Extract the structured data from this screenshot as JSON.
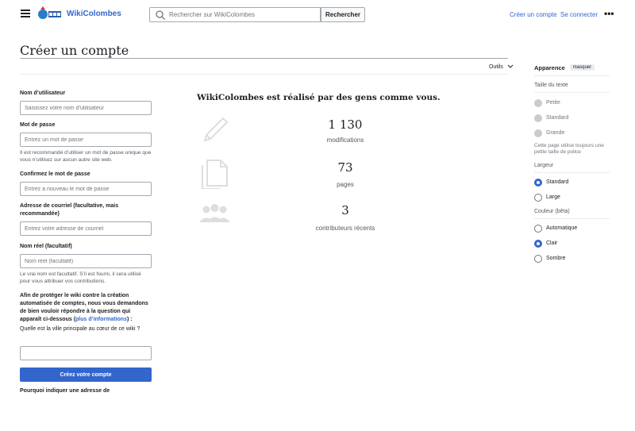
{
  "header": {
    "site_name": "WikiColombes",
    "search_placeholder": "Rechercher sur WikiColombes",
    "search_button": "Rechercher",
    "create_account": "Créer un compte",
    "login": "Se connecter",
    "more": "•••"
  },
  "page": {
    "title": "Créer un compte",
    "tools": "Outils"
  },
  "form": {
    "username_label": "Nom d’utilisateur",
    "username_placeholder": "Saisissez votre nom d’utilisateur",
    "password_label": "Mot de passe",
    "password_placeholder": "Entrez un mot de passe",
    "password_help": "Il est recommandé d’utiliser un mot de passe unique que vous n’utilisez sur aucun autre site web.",
    "confirm_label": "Confirmez le mot de passe",
    "confirm_placeholder": "Entrez à nouveau le mot de passe",
    "email_label": "Adresse de courriel (facultative, mais recommandée)",
    "email_placeholder": "Entrez votre adresse de courriel",
    "realname_label": "Nom réel (facultatif)",
    "realname_placeholder": "Nom réel (facultatif)",
    "realname_help": "Le vrai nom est facultatif. S’il est fourni, il sera utilisé pour vous attribuer vos contributions.",
    "captcha_intro": "Afin de protéger le wiki contre la création automatisée de comptes, nous vous demandons de bien vouloir répondre à la question qui apparaît ci-dessous (",
    "captcha_link": "plus d’informations",
    "captcha_intro_end": ") :",
    "captcha_question": "Quelle est la ville principale au cœur de ce wiki ?",
    "captcha_value": "",
    "submit": "Créez votre compte",
    "email_why": "Pourquoi indiquer une adresse de"
  },
  "stats": {
    "title": "WikiColombes est réalisé par des gens comme vous.",
    "items": [
      {
        "number": "1 130",
        "label": "modifications",
        "icon": "edit-icon"
      },
      {
        "number": "73",
        "label": "pages",
        "icon": "pages-icon"
      },
      {
        "number": "3",
        "label": "contributeurs récents",
        "icon": "users-icon"
      }
    ]
  },
  "appearance": {
    "title": "Apparence",
    "hide": "masquer",
    "text_size_title": "Taille du texte",
    "text_sizes": [
      "Petite",
      "Standard",
      "Grande"
    ],
    "text_size_note": "Cette page utilise toujours une petite taille de police",
    "width_title": "Largeur",
    "widths": [
      "Standard",
      "Large"
    ],
    "width_selected": "Standard",
    "color_title": "Couleur (bêta)",
    "colors": [
      "Automatique",
      "Clair",
      "Sombre"
    ],
    "color_selected": "Clair",
    "accent": "#3366cc"
  }
}
